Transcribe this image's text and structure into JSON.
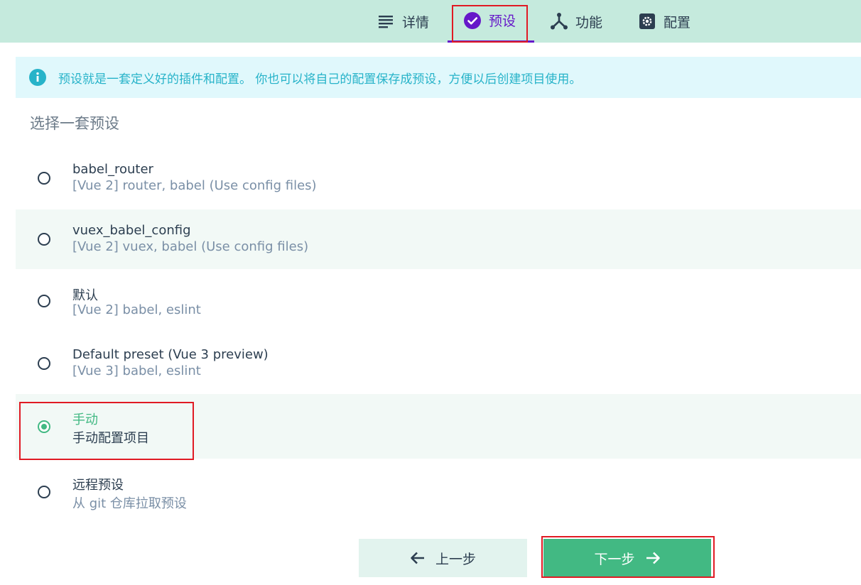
{
  "tabs": [
    {
      "label": "详情",
      "icon": "list-icon"
    },
    {
      "label": "预设",
      "icon": "check-circle-icon",
      "active": true
    },
    {
      "label": "功能",
      "icon": "fork-icon"
    },
    {
      "label": "配置",
      "icon": "gear-icon"
    }
  ],
  "info": {
    "icon": "info-icon",
    "text": "预设就是一套定义好的插件和配置。 你也可以将自己的配置保存成预设，方便以后创建项目使用。"
  },
  "section_title": "选择一套预设",
  "presets": [
    {
      "name": "babel_router",
      "desc": "[Vue 2] router, babel (Use config files)",
      "selected": false
    },
    {
      "name": "vuex_babel_config",
      "desc": "[Vue 2] vuex, babel (Use config files)",
      "selected": false
    },
    {
      "name": "默认",
      "desc": "[Vue 2] babel, eslint",
      "selected": false
    },
    {
      "name": "Default preset (Vue 3 preview)",
      "desc": "[Vue 3] babel, eslint",
      "selected": false
    },
    {
      "name": "手动",
      "desc": "手动配置项目",
      "selected": true
    },
    {
      "name": "远程预设",
      "desc": "从 git 仓库拉取预设",
      "selected": false
    }
  ],
  "buttons": {
    "prev_label": "上一步",
    "next_label": "下一步"
  },
  "colors": {
    "topbar": "#c5eadd",
    "accent_purple": "#6618c9",
    "accent_green": "#42b983",
    "info_bg": "#e0f8fc",
    "info_text": "#27b3c9",
    "highlight": "#e01b24"
  }
}
